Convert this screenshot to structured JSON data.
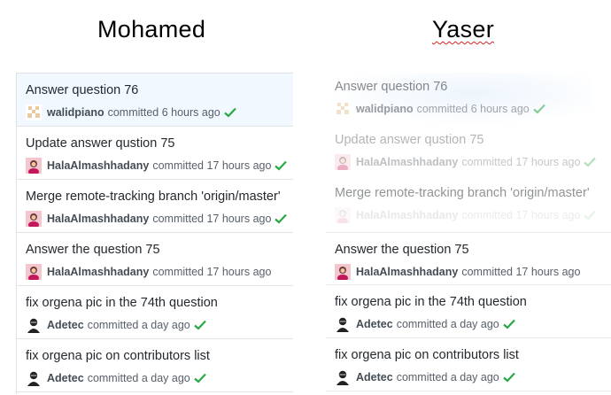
{
  "headings": {
    "left": "Mohamed",
    "right": "Yaser"
  },
  "colors": {
    "check": "#28a745",
    "highlight": "#f1f8ff",
    "author": "#444d56",
    "meta": "#586069"
  },
  "left_commits": [
    {
      "message": "Answer question 76",
      "author": "walidpiano",
      "time": "committed 6 hours ago",
      "check": true,
      "avatar": "pixel-avatar-icon"
    },
    {
      "message": "Update answer qustion 75",
      "author": "HalaAlmashhadany",
      "time": "committed 17 hours ago",
      "check": true,
      "avatar": "photo-avatar-icon"
    },
    {
      "message": "Merge remote-tracking branch 'origin/master'",
      "author": "HalaAlmashhadany",
      "time": "committed 17 hours ago",
      "check": true,
      "avatar": "photo-avatar-icon"
    },
    {
      "message": "Answer the question 75",
      "author": "HalaAlmashhadany",
      "time": "committed 17 hours ago",
      "check": false,
      "avatar": "photo-avatar-icon"
    },
    {
      "message": "fix orgena pic in the 74th question",
      "author": "Adetec",
      "time": "committed a day ago",
      "check": true,
      "avatar": "person-avatar-icon"
    },
    {
      "message": "fix orgena pic on contributors list",
      "author": "Adetec",
      "time": "committed a day ago",
      "check": true,
      "avatar": "person-avatar-icon"
    }
  ],
  "right_commits": [
    {
      "message": "Answer question 76",
      "author": "walidpiano",
      "time": "committed 6 hours ago",
      "check": true,
      "avatar": "pixel-avatar-icon"
    },
    {
      "message": "Update answer qustion 75",
      "author": "HalaAlmashhadany",
      "time": "committed 17 hours ago",
      "check": true,
      "avatar": "photo-avatar-icon"
    },
    {
      "message": "Merge remote-tracking branch 'origin/master'",
      "author": "HalaAlmashhadany",
      "time": "committed 17 hours ago",
      "check": true,
      "avatar": "photo-avatar-icon"
    },
    {
      "message": "Answer the question 75",
      "author": "HalaAlmashhadany",
      "time": "committed 17 hours ago",
      "check": false,
      "avatar": "photo-avatar-icon"
    },
    {
      "message": "fix orgena pic in the 74th question",
      "author": "Adetec",
      "time": "committed a day ago",
      "check": true,
      "avatar": "person-avatar-icon"
    },
    {
      "message": "fix orgena pic on contributors list",
      "author": "Adetec",
      "time": "committed a day ago",
      "check": true,
      "avatar": "person-avatar-icon"
    }
  ]
}
